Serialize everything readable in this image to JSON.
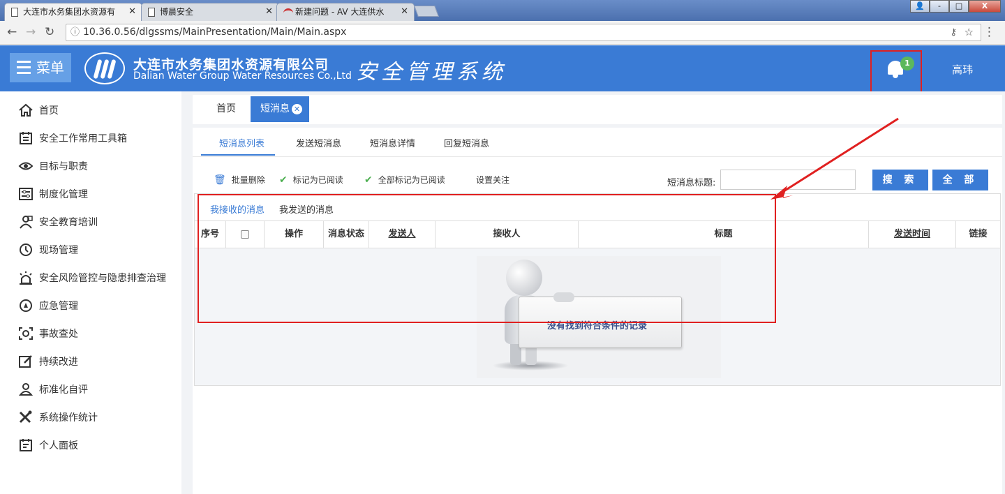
{
  "browser": {
    "tabs": [
      {
        "title": "大连市水务集团水资源有",
        "active": true
      },
      {
        "title": "博晨安全",
        "active": false
      },
      {
        "title": "新建问题 - AV 大连供水",
        "active": false
      }
    ],
    "url": "10.36.0.56/dlgssms/MainPresentation/Main/Main.aspx",
    "window_buttons": {
      "minimize": "-",
      "maximize": "□",
      "close": "X"
    }
  },
  "header": {
    "menu_label": "菜单",
    "company_name_cn": "大连市水务集团水资源有限公司",
    "company_name_en": "Dalian Water Group Water Resources Co.,Ltd",
    "system_name": "安全管理系统",
    "notification_count": "1",
    "username": "高玮",
    "accent_color": "#3a7bd5",
    "badge_color": "#5cb85c"
  },
  "sidebar": {
    "items": [
      {
        "label": "首页",
        "icon": "home-icon"
      },
      {
        "label": "安全工作常用工具箱",
        "icon": "toolbox-icon"
      },
      {
        "label": "目标与职责",
        "icon": "eye-icon"
      },
      {
        "label": "制度化管理",
        "icon": "sliders-icon"
      },
      {
        "label": "安全教育培训",
        "icon": "training-icon"
      },
      {
        "label": "现场管理",
        "icon": "history-icon"
      },
      {
        "label": "安全风险管控与隐患排查治理",
        "icon": "alarm-icon"
      },
      {
        "label": "应急管理",
        "icon": "emergency-icon"
      },
      {
        "label": "事故查处",
        "icon": "scan-icon"
      },
      {
        "label": "持续改进",
        "icon": "edit-icon"
      },
      {
        "label": "标准化自评",
        "icon": "user-icon"
      },
      {
        "label": "系统操作统计",
        "icon": "tools-icon"
      },
      {
        "label": "个人面板",
        "icon": "clipboard-icon"
      }
    ]
  },
  "page_tabs": {
    "home": "首页",
    "current": "短消息",
    "close_symbol": "✕"
  },
  "sub_tabs": [
    "短消息列表",
    "发送短消息",
    "短消息详情",
    "回复短消息"
  ],
  "toolbar": {
    "batch_delete": "批量删除",
    "mark_read": "标记为已阅读",
    "mark_all_read": "全部标记为已阅读",
    "set_follow": "设置关注",
    "search_label": "短消息标题:",
    "search_value": "",
    "search_button": "搜 索",
    "all_button": "全 部"
  },
  "message_tabs": [
    "我接收的消息",
    "我发送的消息"
  ],
  "table": {
    "columns": [
      "序号",
      "",
      "操作",
      "消息状态",
      "发送人",
      "接收人",
      "标题",
      "发送时间",
      "链接"
    ],
    "rows": []
  },
  "empty_message": "没有找到符合条件的记录"
}
